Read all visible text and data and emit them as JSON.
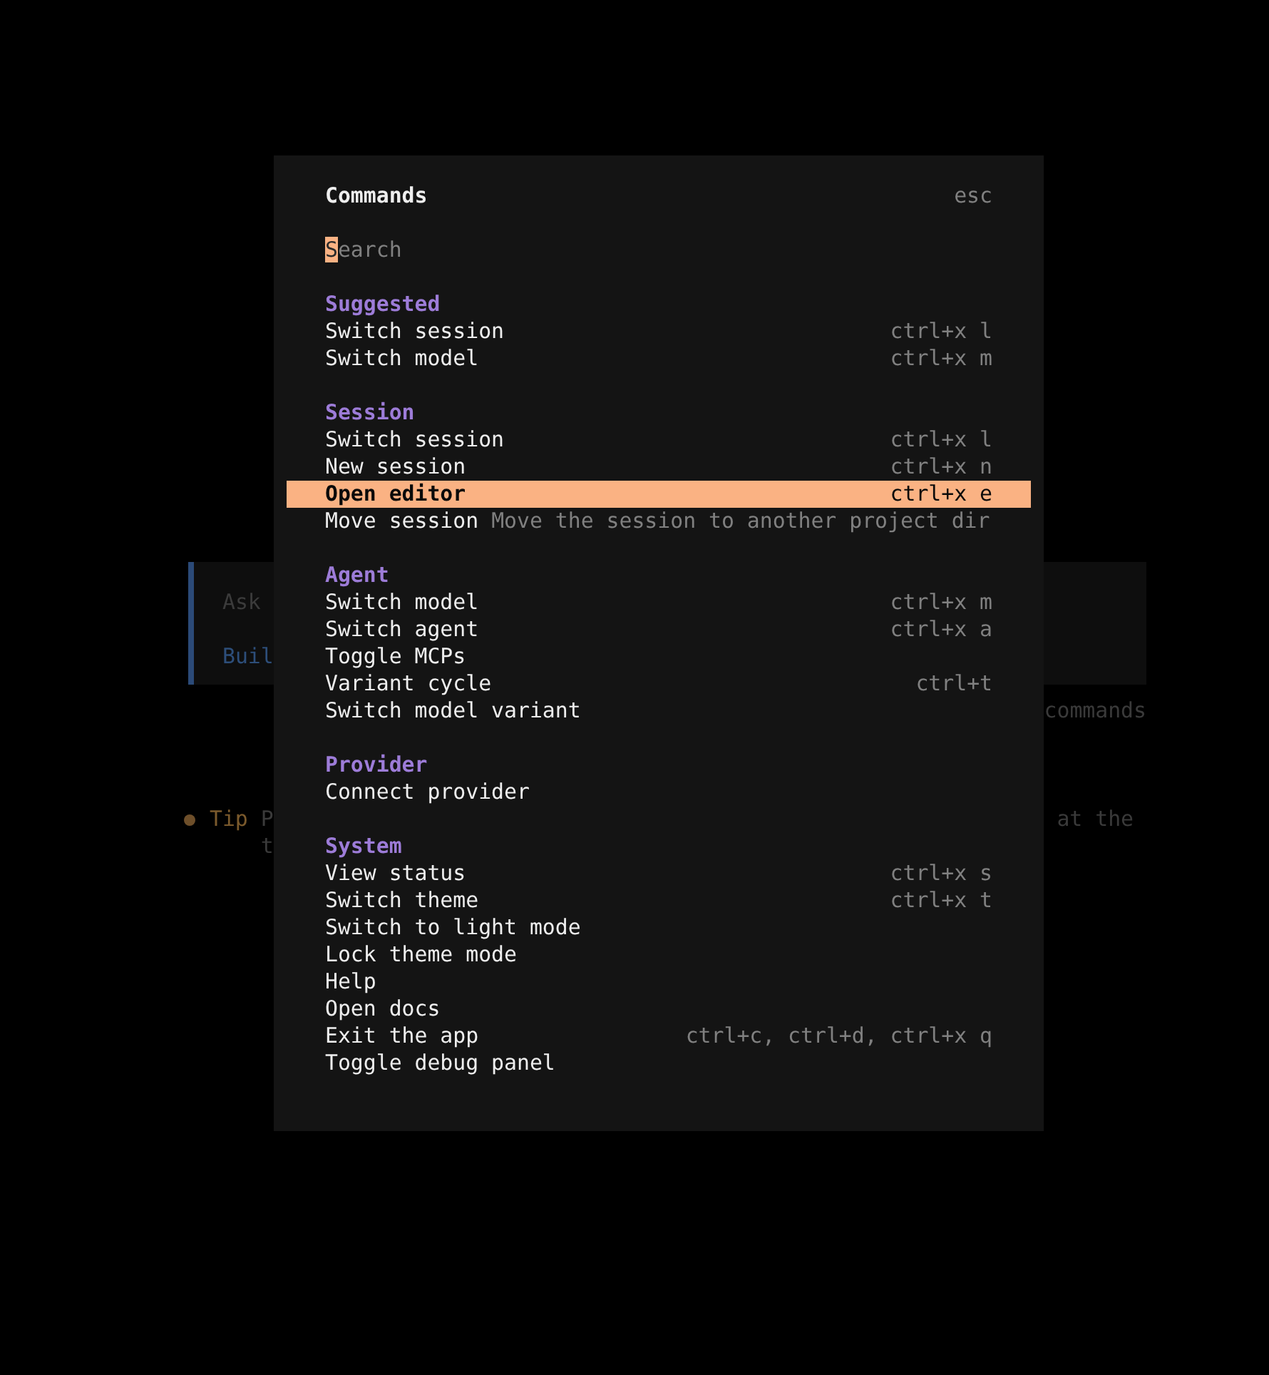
{
  "background": {
    "prompt": {
      "placeholder": "Ask",
      "agent": "Buil"
    },
    "hint": "commands",
    "tip": {
      "label": "Tip",
      "left_lines": [
        "P",
        "t"
      ],
      "right_fragment": "at the"
    }
  },
  "dialog": {
    "title": "Commands",
    "close_hint": "esc",
    "search": {
      "placeholder": "Search",
      "focused": true
    },
    "groups": [
      {
        "title": "Suggested",
        "items": [
          {
            "label": "Switch session",
            "shortcut": "ctrl+x l",
            "selected": false
          },
          {
            "label": "Switch model",
            "shortcut": "ctrl+x m",
            "selected": false
          }
        ]
      },
      {
        "title": "Session",
        "items": [
          {
            "label": "Switch session",
            "shortcut": "ctrl+x l",
            "selected": false
          },
          {
            "label": "New session",
            "shortcut": "ctrl+x n",
            "selected": false
          },
          {
            "label": "Open editor",
            "shortcut": "ctrl+x e",
            "selected": true
          },
          {
            "label": "Move session",
            "description": "Move the session to another project dir",
            "selected": false
          }
        ]
      },
      {
        "title": "Agent",
        "items": [
          {
            "label": "Switch model",
            "shortcut": "ctrl+x m",
            "selected": false
          },
          {
            "label": "Switch agent",
            "shortcut": "ctrl+x a",
            "selected": false
          },
          {
            "label": "Toggle MCPs",
            "selected": false
          },
          {
            "label": "Variant cycle",
            "shortcut": "ctrl+t",
            "selected": false
          },
          {
            "label": "Switch model variant",
            "selected": false
          }
        ]
      },
      {
        "title": "Provider",
        "items": [
          {
            "label": "Connect provider",
            "selected": false
          }
        ]
      },
      {
        "title": "System",
        "items": [
          {
            "label": "View status",
            "shortcut": "ctrl+x s",
            "selected": false
          },
          {
            "label": "Switch theme",
            "shortcut": "ctrl+x t",
            "selected": false
          },
          {
            "label": "Switch to light mode",
            "selected": false
          },
          {
            "label": "Lock theme mode",
            "selected": false
          },
          {
            "label": "Help",
            "selected": false
          },
          {
            "label": "Open docs",
            "selected": false
          },
          {
            "label": "Exit the app",
            "shortcut": "ctrl+c, ctrl+d, ctrl+x q",
            "selected": false
          },
          {
            "label": "Toggle debug panel",
            "selected": false
          }
        ]
      }
    ]
  }
}
